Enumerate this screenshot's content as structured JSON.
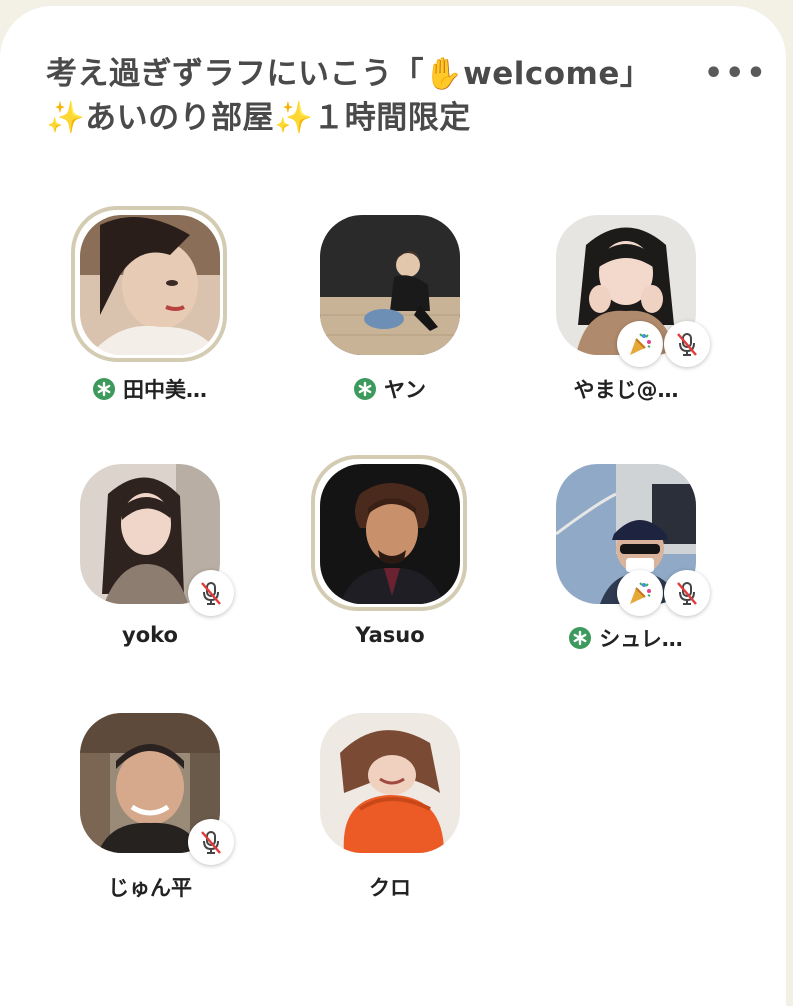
{
  "room": {
    "title": "考え過ぎずラフにいこう「✋welcome」✨あいのり部屋✨１時間限定",
    "menu_label": "•••"
  },
  "colors": {
    "speaking_ring": "#d3ccb2",
    "moderator_badge": "#3c9a5c",
    "mute_slash": "#e03a3a"
  },
  "speakers": [
    {
      "name": "田中美…",
      "moderator": true,
      "speaking": true,
      "muted": false,
      "new_member": false
    },
    {
      "name": "ヤン",
      "moderator": true,
      "speaking": false,
      "muted": false,
      "new_member": false
    },
    {
      "name": "やまじ@…",
      "moderator": false,
      "speaking": false,
      "muted": true,
      "new_member": true
    },
    {
      "name": "yoko",
      "moderator": false,
      "speaking": false,
      "muted": true,
      "new_member": false
    },
    {
      "name": "Yasuo",
      "moderator": false,
      "speaking": true,
      "muted": false,
      "new_member": false
    },
    {
      "name": "シュレ…",
      "moderator": true,
      "speaking": false,
      "muted": true,
      "new_member": true
    },
    {
      "name": "じゅん平",
      "moderator": false,
      "speaking": false,
      "muted": true,
      "new_member": false
    },
    {
      "name": "クロ",
      "moderator": false,
      "speaking": false,
      "muted": false,
      "new_member": false
    }
  ],
  "icons": {
    "moderator": "moderator-asterisk-icon",
    "mute": "muted-mic-icon",
    "new_member": "party-popper-icon",
    "menu": "more-options-icon"
  }
}
